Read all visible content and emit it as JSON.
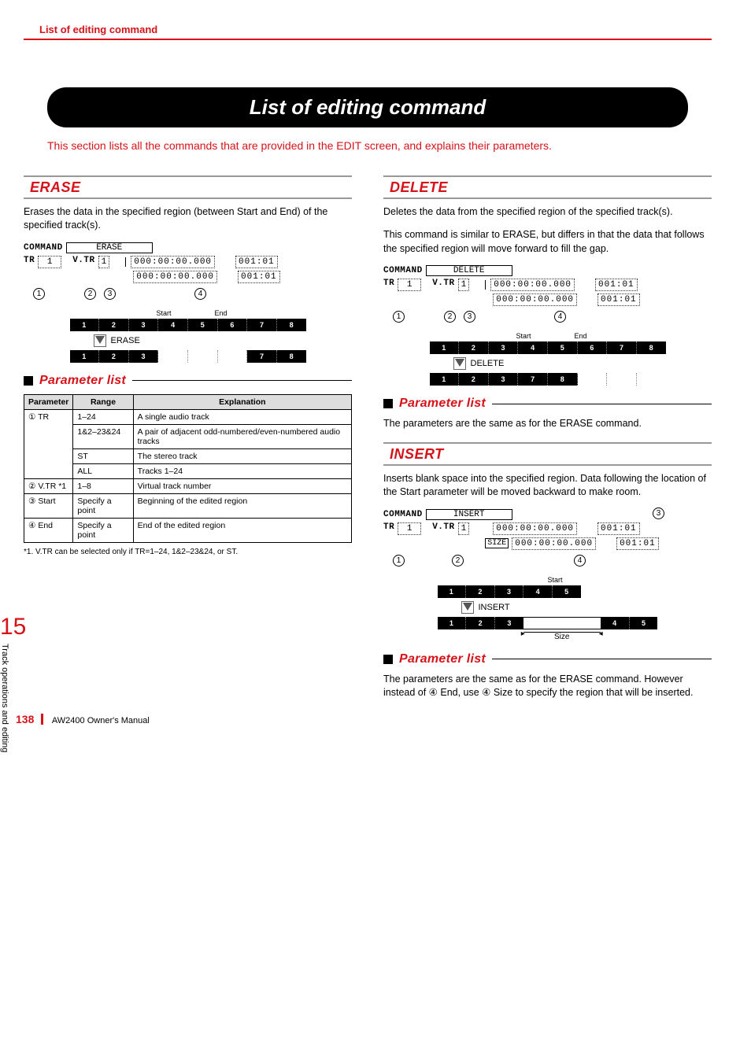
{
  "header": {
    "title": "List of editing command"
  },
  "main_title": "List of editing command",
  "intro": "This section lists all the commands that are provided in the EDIT screen, and explains their parameters.",
  "side": {
    "chapter_num": "15",
    "chapter_text": "Track operations and editing"
  },
  "erase": {
    "heading": "ERASE",
    "desc": "Erases the data in the specified region (between Start and End) of the specified track(s).",
    "lcd": {
      "command_label": "COMMAND",
      "command_value": "ERASE",
      "tr_label": "TR",
      "tr_value": "1",
      "vtr_label": "V.TR",
      "vtr_value": "1",
      "time1": "000:00:00.000",
      "extra1": "001:01",
      "time2": "000:00:00.000",
      "extra2": "001:01"
    },
    "callouts": [
      "1",
      "2",
      "3",
      "4"
    ],
    "timeline": {
      "start": "Start",
      "end": "End",
      "row_before": [
        "1",
        "2",
        "3",
        "4",
        "5",
        "6",
        "7",
        "8"
      ],
      "action": "ERASE",
      "row_after": [
        "1",
        "2",
        "3",
        "",
        "",
        "",
        "7",
        "8"
      ]
    },
    "param_heading": "Parameter list",
    "table": {
      "cols": [
        "Parameter",
        "Range",
        "Explanation"
      ],
      "rows": [
        {
          "p": "① TR",
          "r": "1–24",
          "e": "A single audio track"
        },
        {
          "p": "",
          "r": "1&2–23&24",
          "e": "A pair of adjacent odd-numbered/even-numbered audio tracks"
        },
        {
          "p": "",
          "r": "ST",
          "e": "The stereo track"
        },
        {
          "p": "",
          "r": "ALL",
          "e": "Tracks 1–24"
        },
        {
          "p": "② V.TR *1",
          "r": "1–8",
          "e": "Virtual track number"
        },
        {
          "p": "③ Start",
          "r": "Specify a point",
          "e": "Beginning of the edited region"
        },
        {
          "p": "④ End",
          "r": "Specify a point",
          "e": "End of the edited region"
        }
      ]
    },
    "footnote": "*1. V.TR can be selected only if TR=1–24, 1&2–23&24, or ST."
  },
  "delete": {
    "heading": "DELETE",
    "desc1": "Deletes the data from the specified region of the specified track(s).",
    "desc2": "This command is similar to ERASE, but differs in that the data that follows the specified region will move forward to fill the gap.",
    "lcd": {
      "command_label": "COMMAND",
      "command_value": "DELETE",
      "tr_label": "TR",
      "tr_value": "1",
      "vtr_label": "V.TR",
      "vtr_value": "1",
      "time1": "000:00:00.000",
      "extra1": "001:01",
      "time2": "000:00:00.000",
      "extra2": "001:01"
    },
    "callouts": [
      "1",
      "2",
      "3",
      "4"
    ],
    "timeline": {
      "start": "Start",
      "end": "End",
      "row_before": [
        "1",
        "2",
        "3",
        "4",
        "5",
        "6",
        "7",
        "8"
      ],
      "action": "DELETE",
      "row_after": [
        "1",
        "2",
        "3",
        "7",
        "8",
        "",
        "",
        ""
      ]
    },
    "param_heading": "Parameter list",
    "param_text": "The parameters are the same as for the ERASE command."
  },
  "insert": {
    "heading": "INSERT",
    "desc": "Inserts blank space into the specified region. Data following the location of the Start parameter will be moved backward to make room.",
    "lcd": {
      "command_label": "COMMAND",
      "command_value": "INSERT",
      "tr_label": "TR",
      "tr_value": "1",
      "vtr_label": "V.TR",
      "vtr_value": "1",
      "time1": "000:00:00.000",
      "extra1": "001:01",
      "size_label": "SIZE",
      "time2": "000:00:00.000",
      "extra2": "001:01"
    },
    "callouts": [
      "1",
      "2",
      "3",
      "4"
    ],
    "timeline": {
      "start": "Start",
      "row_before": [
        "1",
        "2",
        "3",
        "4",
        "5"
      ],
      "action": "INSERT",
      "row_after_a": [
        "1",
        "2",
        "3"
      ],
      "row_after_b": [
        "4",
        "5"
      ],
      "size": "Size"
    },
    "param_heading": "Parameter list",
    "param_text": "The parameters are the same as for the ERASE command. However instead of ④ End, use ④ Size to specify the region that will be inserted."
  },
  "footer": {
    "page": "138",
    "manual": "AW2400  Owner's Manual"
  }
}
